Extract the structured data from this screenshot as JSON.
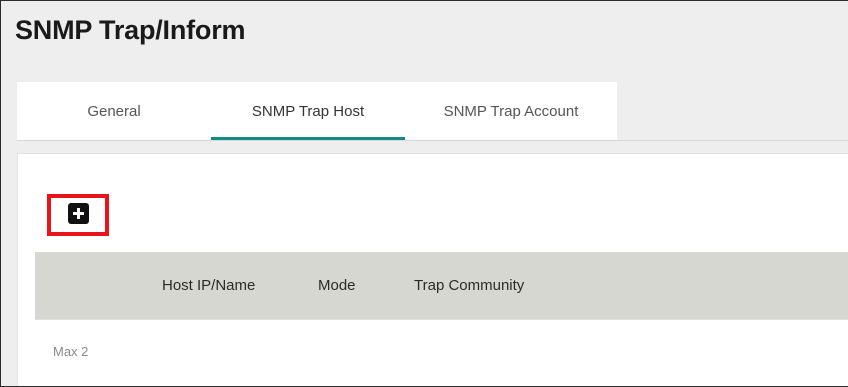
{
  "page": {
    "title": "SNMP Trap/Inform"
  },
  "tabs": [
    {
      "label": "General",
      "active": false
    },
    {
      "label": "SNMP Trap Host",
      "active": true
    },
    {
      "label": "SNMP Trap Account",
      "active": false
    }
  ],
  "toolbar": {
    "add_icon": "plus-square-icon",
    "highlight_color": "#e8141c"
  },
  "table": {
    "columns": [
      "Host IP/Name",
      "Mode",
      "Trap Community"
    ],
    "rows": []
  },
  "footer": {
    "max_note": "Max 2"
  },
  "colors": {
    "accent": "#0f8c8a",
    "header_bg": "#d7d7d2",
    "page_bg": "#eeeeee"
  }
}
